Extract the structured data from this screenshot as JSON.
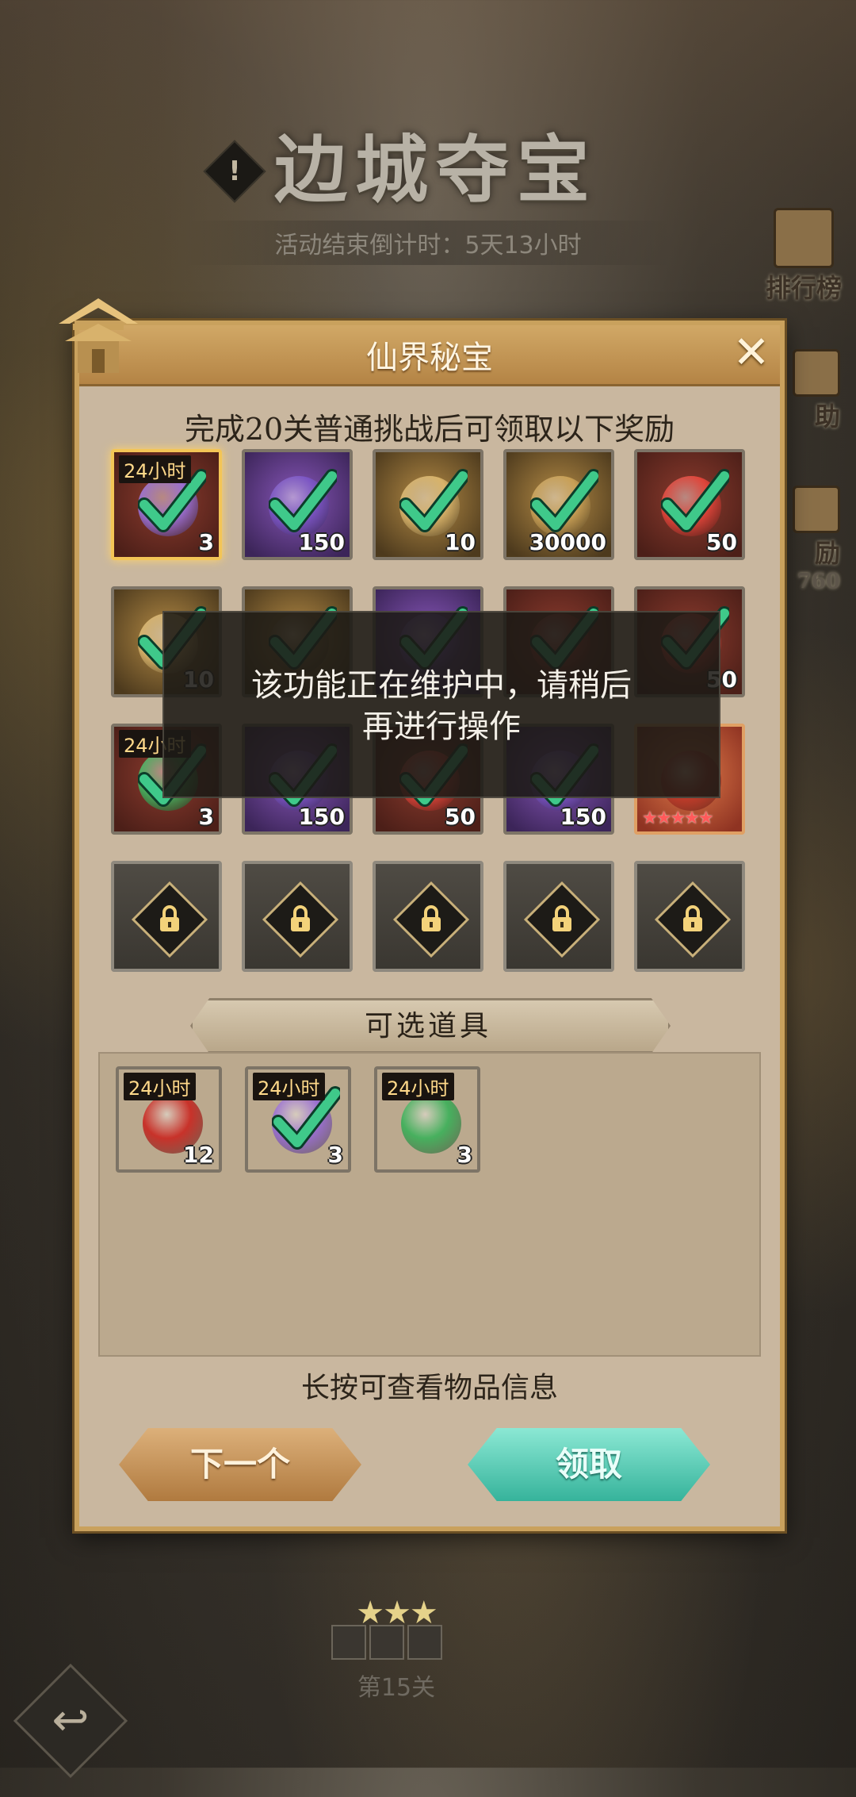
{
  "event": {
    "title": "边城夺宝",
    "countdown": "活动结束倒计时：5天13小时",
    "info_icon": "!"
  },
  "side_buttons": [
    {
      "label": "排行榜",
      "icon": "ranking-icon"
    },
    {
      "label": "助",
      "icon": "assist-icon"
    },
    {
      "label": "励",
      "icon": "reward-icon",
      "extra": "760"
    }
  ],
  "dialog": {
    "title": "仙界秘宝",
    "subtitle": "完成20关普通挑战后可领取以下奖励",
    "close_icon": "✕",
    "rewards": [
      [
        {
          "type": "red",
          "tag": "24小时",
          "qty": "3",
          "claimed": true,
          "selected": true,
          "icon": "purple-crystal-icon"
        },
        {
          "type": "purple",
          "tag": "",
          "qty": "150",
          "claimed": true,
          "icon": "purple-ore-icon"
        },
        {
          "type": "gold",
          "tag": "",
          "qty": "10",
          "claimed": true,
          "icon": "scroll-ticket-icon"
        },
        {
          "type": "gold",
          "tag": "",
          "qty": "30000",
          "claimed": true,
          "icon": "coin-icon"
        },
        {
          "type": "red",
          "tag": "",
          "qty": "50",
          "claimed": true,
          "icon": "red-orb-icon"
        }
      ],
      [
        {
          "type": "gold",
          "tag": "",
          "qty": "10",
          "claimed": true,
          "icon": "scroll-ticket-icon"
        },
        {
          "type": "gold",
          "tag": "",
          "qty": "",
          "claimed": true,
          "icon": "treasure-icon"
        },
        {
          "type": "purple",
          "tag": "",
          "qty": "",
          "claimed": true,
          "icon": "purple-ore-icon"
        },
        {
          "type": "red",
          "tag": "",
          "qty": "",
          "claimed": true,
          "icon": "red-item-icon"
        },
        {
          "type": "red",
          "tag": "",
          "qty": "50",
          "claimed": true,
          "icon": "red-orb-icon"
        }
      ],
      [
        {
          "type": "red",
          "tag": "24小时",
          "qty": "3",
          "claimed": true,
          "icon": "jade-chest-icon"
        },
        {
          "type": "purple",
          "tag": "",
          "qty": "150",
          "claimed": true,
          "icon": "purple-ore-icon"
        },
        {
          "type": "red",
          "tag": "",
          "qty": "50",
          "claimed": true,
          "icon": "red-orb-icon"
        },
        {
          "type": "purple",
          "tag": "",
          "qty": "150",
          "claimed": true,
          "icon": "purple-ore-icon"
        },
        {
          "type": "orange",
          "tag": "",
          "qty": "",
          "claimed": false,
          "stars": "★★★★★",
          "icon": "fire-gift-icon"
        }
      ],
      [
        {
          "type": "locked",
          "icon": "lock-icon"
        },
        {
          "type": "locked",
          "icon": "lock-icon"
        },
        {
          "type": "locked",
          "icon": "lock-icon"
        },
        {
          "type": "locked",
          "icon": "lock-icon"
        },
        {
          "type": "locked",
          "icon": "lock-icon"
        }
      ]
    ],
    "optional_label": "可选道具",
    "optional_items": [
      {
        "type": "orange",
        "tag": "24小时",
        "qty": "12",
        "icon": "red-gold-chest-icon"
      },
      {
        "type": "red",
        "tag": "24小时",
        "qty": "3",
        "claimed": true,
        "icon": "purple-crystal-icon"
      },
      {
        "type": "orange",
        "tag": "24小时",
        "qty": "3",
        "icon": "jade-chest-icon"
      }
    ],
    "hint": "长按可查看物品信息",
    "next_button": "下一个",
    "claim_button": "领取"
  },
  "toast": {
    "line1": "该功能正在维护中，请稍后",
    "line2": "再进行操作"
  },
  "stage": {
    "stars": "★★★",
    "label": "第15关"
  },
  "colors": {
    "dialog_bg": "#c9b79f",
    "dialog_border": "#c9a15d",
    "claim_green": "#36b39b",
    "next_gold": "#b07a3f",
    "check_green": "#3fc98a"
  }
}
